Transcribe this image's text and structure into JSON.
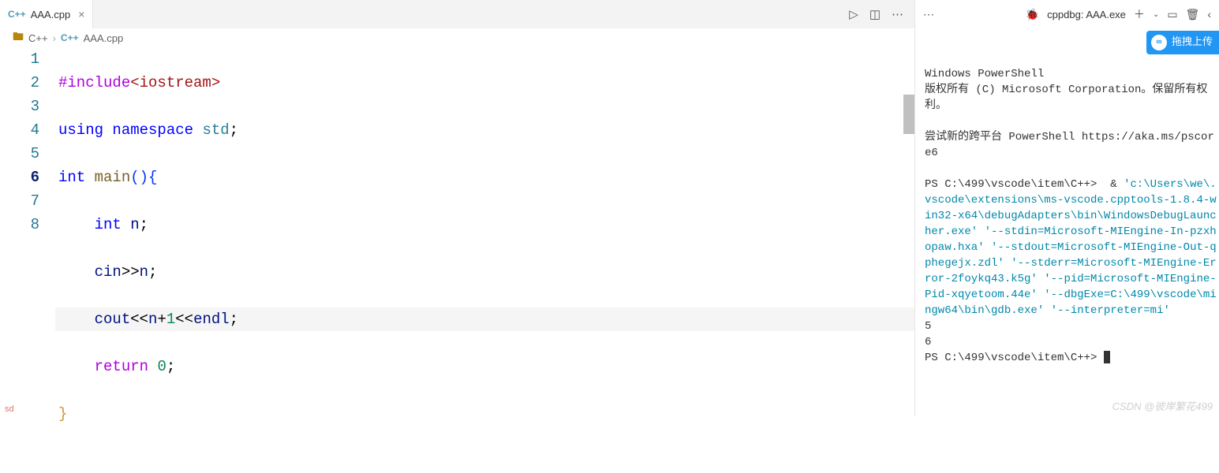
{
  "tab": {
    "filename": "AAA.cpp",
    "iconText": "C++"
  },
  "breadcrumb": {
    "folder": "C++",
    "file": "AAA.cpp",
    "iconText": "C++"
  },
  "code": {
    "lineNumbers": [
      "1",
      "2",
      "3",
      "4",
      "5",
      "6",
      "7",
      "8"
    ],
    "currentLine": 6,
    "tokens": {
      "l1_pp": "#include",
      "l1_inc": "<iostream>",
      "l2_kw1": "using",
      "l2_kw2": "namespace",
      "l2_ns": "std",
      "l2_semi": ";",
      "l3_kw": "int",
      "l3_fn": "main",
      "l3_lp": "(",
      "l3_rp": ")",
      "l3_lb": "{",
      "l4_kw": "int",
      "l4_var": "n",
      "l4_semi": ";",
      "l5_cin": "cin",
      "l5_op": ">>",
      "l5_var": "n",
      "l5_semi": ";",
      "l6_cout": "cout",
      "l6_op1": "<<",
      "l6_var": "n",
      "l6_plus": "+",
      "l6_one": "1",
      "l6_op2": "<<",
      "l6_endl": "endl",
      "l6_semi": ";",
      "l7_kw": "return",
      "l7_zero": "0",
      "l7_semi": ";",
      "l8_rb": "}"
    }
  },
  "terminal": {
    "debugLabel": "cppdbg: AAA.exe",
    "header_line1": "Windows PowerShell",
    "header_line2": "版权所有 (C) Microsoft Corporation。保留所有权利。",
    "tip": "尝试新的跨平台 PowerShell https://aka.ms/pscore6",
    "prompt1_path": "PS C:\\499\\vscode\\item\\C++> ",
    "prompt1_amp": " & ",
    "cmd_part1": "'c:\\Users\\we\\.vscode\\extensions\\ms-vscode.cpptools-1.8.4-win32-x64\\debugAdapters\\bin\\WindowsDebugLauncher.exe'",
    "cmd_part2": "'--stdin=Microsoft-MIEngine-In-pzxhopaw.hxa'",
    "cmd_part3": "'--stdout=Microsoft-MIEngine-Out-qphegejx.zdl'",
    "cmd_part4": "'--stderr=Microsoft-MIEngine-Error-2foykq43.k5g'",
    "cmd_part5": "'--pid=Microsoft-MIEngine-Pid-xqyetoom.44e'",
    "cmd_part6": "'--dbgExe=C:\\499\\vscode\\mingw64\\bin\\gdb.exe'",
    "cmd_part7": "'--interpreter=mi'",
    "out_input": "5",
    "out_output": "6",
    "prompt2": "PS C:\\499\\vscode\\item\\C++> "
  },
  "upload": {
    "label": "拖拽上传",
    "icon": "∞"
  },
  "watermark_bl": "sd",
  "watermark_br": "CSDN @彼岸繁花499"
}
